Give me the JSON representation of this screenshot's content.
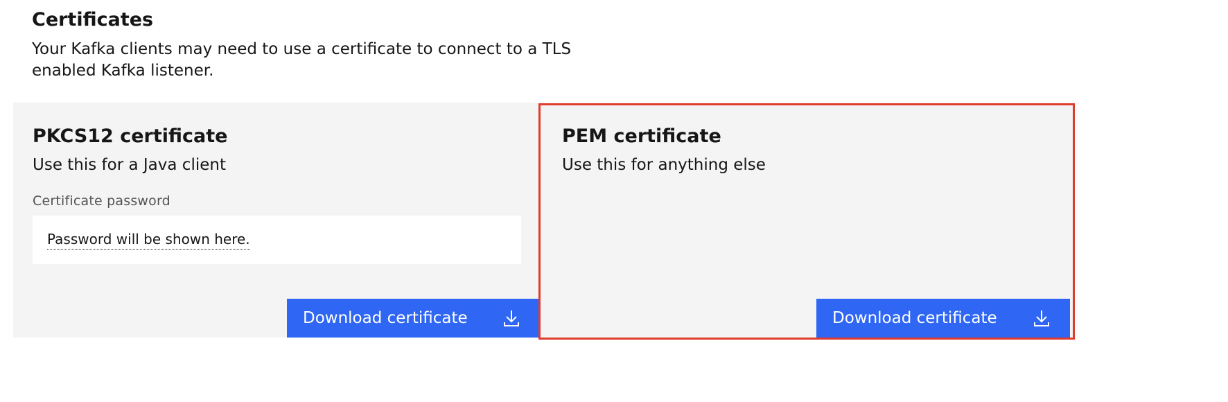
{
  "section": {
    "title": "Certificates",
    "description": "Your Kafka clients may need to use a certificate to connect to a TLS enabled Kafka listener."
  },
  "pkcs12": {
    "title": "PKCS12 certificate",
    "subtitle": "Use this for a Java client",
    "password_label": "Certificate password",
    "password_placeholder": "Password will be shown here.",
    "download_label": "Download certificate",
    "download_icon": "download-icon"
  },
  "pem": {
    "title": "PEM certificate",
    "subtitle": "Use this for anything else",
    "download_label": "Download certificate",
    "download_icon": "download-icon"
  },
  "colors": {
    "button_primary": "#2f67f4",
    "tile_background": "#f4f4f4",
    "highlight_border": "#e03c2d"
  }
}
